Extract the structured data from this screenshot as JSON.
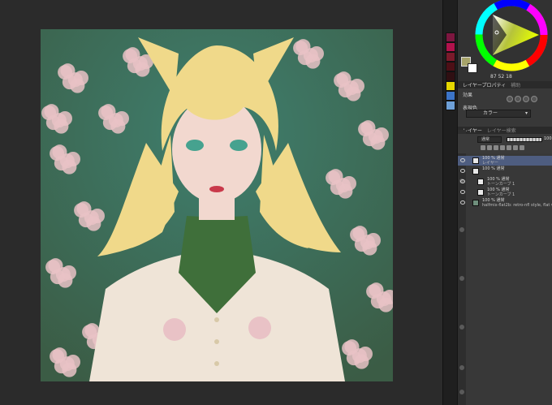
{
  "artwork": {
    "colors": {
      "background_teal": "#3f7f6e",
      "foliage": "#3b5c45",
      "flower_pink": "#e9c2c6",
      "hair_blonde": "#f0d98a",
      "skin": "#f2d8cf",
      "collar_green": "#3f6f3a",
      "dress": "#efe4d7",
      "lips": "#c9394a",
      "eyes": "#46a28f"
    }
  },
  "palette": {
    "swatches": [
      "#7d1740",
      "#b1124c",
      "#7b1a2b",
      "#4d0f16",
      "#2f0f12",
      "#e4d700",
      "#3c74c8",
      "#6ea0d8"
    ]
  },
  "color_panel": {
    "readout_values": [
      "87",
      "52",
      "18"
    ]
  },
  "layer_property": {
    "header_tabs": [
      "レイヤープロパティ",
      "補助"
    ],
    "effect_label": "効果",
    "expression_label": "表現色",
    "expression_value": "カラー"
  },
  "layer_panel": {
    "header_tabs": [
      "レイヤー",
      "レイヤー検索"
    ],
    "blend_mode": "通常",
    "opacity_value": "100",
    "layers": [
      {
        "name": "100 % 通常",
        "sub": "レイヤー",
        "selected": true
      },
      {
        "name": "100 % 通常",
        "sub": "",
        "selected": false
      },
      {
        "name": "100 % 通常",
        "sub": "トーンカーブ 1",
        "selected": false
      },
      {
        "name": "100 % 通常",
        "sub": "トーンカーブ 1",
        "selected": false
      },
      {
        "name": "100 % 通常",
        "sub": "halfmix-flat2b: retro-nfl style, flat vec...",
        "selected": false
      }
    ]
  }
}
